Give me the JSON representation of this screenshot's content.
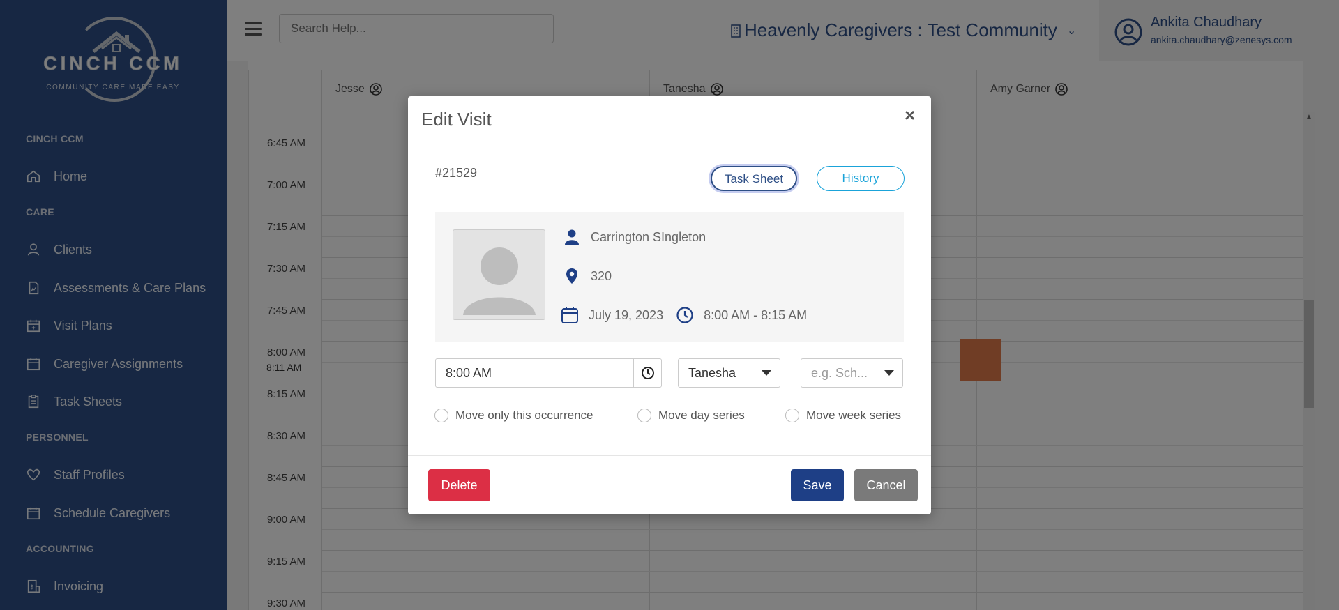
{
  "sidebar": {
    "logo": {
      "brand": "CINCH CCM",
      "tagline": "COMMUNITY CARE MADE EASY"
    },
    "sections": [
      {
        "title": "CINCH CCM",
        "items": [
          {
            "label": "Home",
            "icon": "home-icon"
          }
        ]
      },
      {
        "title": "CARE",
        "items": [
          {
            "label": "Clients",
            "icon": "user-icon"
          },
          {
            "label": "Assessments & Care Plans",
            "icon": "document-chart-icon"
          },
          {
            "label": "Visit Plans",
            "icon": "calendar-plus-icon"
          },
          {
            "label": "Caregiver Assignments",
            "icon": "calendar-icon"
          },
          {
            "label": "Task Sheets",
            "icon": "clipboard-icon"
          }
        ]
      },
      {
        "title": "PERSONNEL",
        "items": [
          {
            "label": "Staff Profiles",
            "icon": "heart-hand-icon"
          },
          {
            "label": "Schedule Caregivers",
            "icon": "calendar-icon"
          }
        ]
      },
      {
        "title": "ACCOUNTING",
        "items": [
          {
            "label": "Invoicing",
            "icon": "invoice-icon"
          }
        ]
      }
    ]
  },
  "header": {
    "search_placeholder": "Search Help...",
    "community": "Heavenly Caregivers : Test Community",
    "user_name": "Ankita Chaudhary",
    "user_email": "ankita.chaudhary@zenesys.com"
  },
  "calendar": {
    "columns": [
      "Jesse",
      "Tanesha",
      "Amy Garner"
    ],
    "times": [
      "6:45 AM",
      "7:00 AM",
      "7:15 AM",
      "7:30 AM",
      "7:45 AM",
      "8:00 AM",
      "8:15 AM",
      "8:30 AM",
      "8:45 AM",
      "9:00 AM",
      "9:15 AM",
      "9:30 AM"
    ],
    "now_label": "8:11 AM"
  },
  "modal": {
    "title": "Edit Visit",
    "close": "×",
    "visit_id": "#21529",
    "task_sheet_label": "Task Sheet",
    "history_label": "History",
    "client_name": "Carrington SIngleton",
    "location": "320",
    "date": "July 19, 2023",
    "time_range": "8:00 AM - 8:15 AM",
    "start_time": "8:00 AM",
    "caregiver": "Tanesha",
    "schedule_placeholder": "e.g. Sch...",
    "radio_options": [
      "Move only this occurrence",
      "Move day series",
      "Move week series"
    ],
    "delete_label": "Delete",
    "save_label": "Save",
    "cancel_label": "Cancel"
  },
  "colors": {
    "sidebar_bg": "#2e4f86",
    "primary": "#1e3f86",
    "danger": "#dc2f45",
    "secondary": "#7a7a7a",
    "info": "#1aa3d9",
    "event": "#e07b4a"
  }
}
